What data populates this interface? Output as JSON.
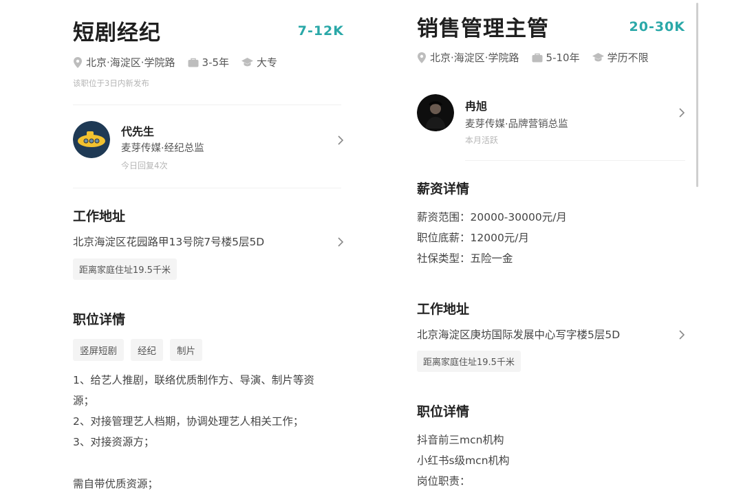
{
  "left": {
    "title": "短剧经纪",
    "salary": "7-12K",
    "location": "北京·海淀区·学院路",
    "experience": "3-5年",
    "education": "大专",
    "posted_hint": "该职位于3日内新发布",
    "recruiter": {
      "name": "代先生",
      "role": "麦芽传媒·经纪总监",
      "activity": "今日回复4次"
    },
    "address_section": {
      "title": "工作地址",
      "address": "北京海淀区花园路甲13号院7号楼5层5D",
      "distance": "距离家庭住址19.5千米"
    },
    "details_section": {
      "title": "职位详情",
      "tags": [
        "竖屏短剧",
        "经纪",
        "制片"
      ],
      "lines": [
        "1、给艺人推剧，联络优质制作方、导演、制片等资",
        "源；",
        "2、对接管理艺人档期，协调处理艺人相关工作；",
        "3、对接资源方；",
        "",
        "需自带优质资源；"
      ]
    }
  },
  "right": {
    "title": "销售管理主管",
    "salary": "20-30K",
    "location": "北京·海淀区·学院路",
    "experience": "5-10年",
    "education": "学历不限",
    "recruiter": {
      "name": "冉旭",
      "role": "麦芽传媒·品牌营销总监",
      "activity": "本月活跃"
    },
    "salary_section": {
      "title": "薪资详情",
      "lines": [
        "薪资范围：20000-30000元/月",
        "职位底薪：12000元/月",
        "社保类型：五险一金"
      ]
    },
    "address_section": {
      "title": "工作地址",
      "address": "北京海淀区庚坊国际发展中心写字楼5层5D",
      "distance": "距离家庭住址19.5千米"
    },
    "details_section": {
      "title": "职位详情",
      "lines": [
        "抖音前三mcn机构",
        "小红书s级mcn机构",
        "岗位职责："
      ]
    }
  },
  "icons": [
    "location-pin-icon",
    "briefcase-icon",
    "graduation-cap-icon",
    "chevron-right-icon"
  ],
  "colors": {
    "salary": "#2aa8a8",
    "text": "#222222",
    "muted": "#b5b5b5",
    "tag_bg": "#f4f4f4"
  }
}
